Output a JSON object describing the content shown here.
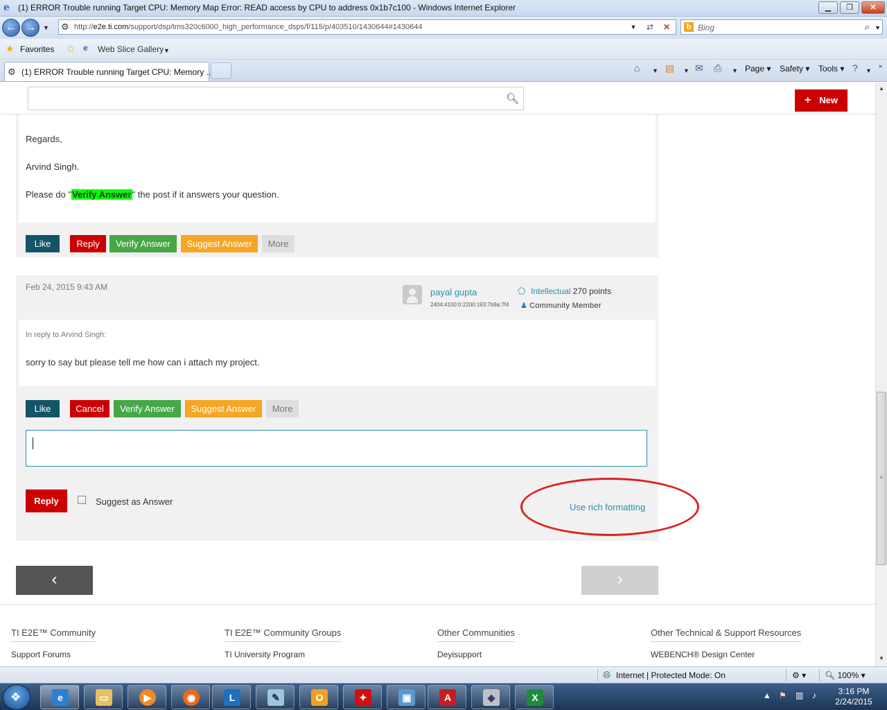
{
  "window": {
    "title": "(1) ERROR Trouble running Target CPU: Memory Map Error: READ access by CPU to address 0x1b7c100 - Windows Internet Explorer",
    "minimize": "▁",
    "restore": "❐",
    "close": "✕"
  },
  "address_bar": {
    "url_prefix": "http://",
    "url_domain": "e2e.ti.com",
    "url_path": "/support/dsp/tms320c6000_high_performance_dsps/f/115/p/403510/1430644#1430644"
  },
  "search_provider": {
    "placeholder": "Bing"
  },
  "favorites_bar": {
    "favorites_label": "Favorites",
    "web_slice_label": "Web Slice Gallery"
  },
  "tabs": [
    {
      "label": "(1) ERROR Trouble running Target CPU: Memory ..."
    }
  ],
  "command_bar": {
    "page": "Page",
    "safety": "Safety",
    "tools": "Tools"
  },
  "site_header": {
    "new_label": "New"
  },
  "post1": {
    "regards": "Regards,",
    "signature": "Arvind Singh.",
    "verify_prefix": "Please do \"",
    "verify_highlight": "Verify Answer",
    "verify_suffix": "\" the post if it answers your question.",
    "actions": {
      "like": "Like",
      "reply": "Reply",
      "verify": "Verify Answer",
      "suggest": "Suggest Answer",
      "more": "More"
    }
  },
  "post2": {
    "date": "Feb 24, 2015 9:43 AM",
    "author": "payal gupta",
    "ip": "2404:4100:0:2200:193:7b8a:7f4",
    "rank": "Intellectual",
    "points": "270 points",
    "role": "Community Member",
    "in_reply_to": "In reply to Arvind Singh:",
    "body": "sorry to say but please tell me how can i attach my project.",
    "actions": {
      "like": "Like",
      "cancel": "Cancel",
      "verify": "Verify Answer",
      "suggest": "Suggest Answer",
      "more": "More"
    }
  },
  "reply_form": {
    "reply_button": "Reply",
    "suggest_checkbox_label": "Suggest as Answer",
    "rich_formatting_link": "Use rich formatting"
  },
  "pager": {
    "prev": "‹",
    "next": "›"
  },
  "footer": {
    "columns": [
      {
        "title": "TI E2E™ Community",
        "link": "Support Forums"
      },
      {
        "title": "TI E2E™ Community Groups",
        "link": "TI University Program"
      },
      {
        "title": "Other Communities",
        "link": "Deyisupport"
      },
      {
        "title": "Other Technical & Support Resources",
        "link": "WEBENCH® Design Center"
      }
    ]
  },
  "status_bar": {
    "zone": "Internet | Protected Mode: On",
    "zoom": "100%"
  },
  "taskbar": {
    "time": "3:16 PM",
    "date": "2/24/2015"
  },
  "colors": {
    "ti_red": "#cc0000",
    "like_teal": "#115566",
    "verify_green": "#45a845",
    "suggest_orange": "#f5a623",
    "link_teal": "#2a8fa8",
    "annotation_red": "#e02020"
  }
}
